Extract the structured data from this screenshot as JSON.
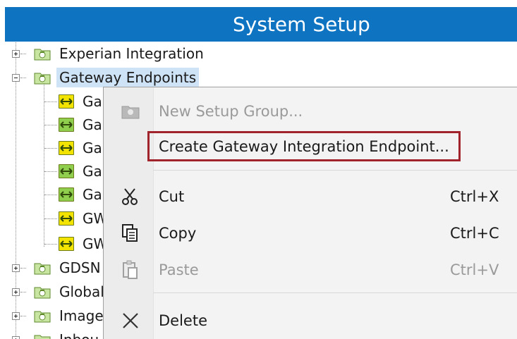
{
  "window": {
    "title": "System Setup"
  },
  "tree": {
    "nodes": [
      {
        "label": "Experian Integration",
        "expanded": false
      },
      {
        "label": "Gateway Endpoints",
        "expanded": true,
        "selected": true
      },
      {
        "label": "Ga",
        "icon_color": "yellow"
      },
      {
        "label": "Ga",
        "icon_color": "green"
      },
      {
        "label": "Ga",
        "icon_color": "yellow"
      },
      {
        "label": "Ga",
        "icon_color": "green"
      },
      {
        "label": "Ga",
        "icon_color": "green"
      },
      {
        "label": "GW",
        "icon_color": "yellow"
      },
      {
        "label": "GW",
        "icon_color": "yellow"
      },
      {
        "label": "GDSN",
        "expanded": false
      },
      {
        "label": "Global",
        "expanded": false
      },
      {
        "label": "Image",
        "expanded": false
      },
      {
        "label": "Inbou",
        "expanded": false
      }
    ]
  },
  "context_menu": {
    "items": [
      {
        "label": "New Setup Group...",
        "shortcut": "",
        "disabled": true,
        "icon": "folder-icon"
      },
      {
        "label": "Create Gateway Integration Endpoint...",
        "shortcut": "",
        "disabled": false,
        "highlighted": true
      },
      {
        "label": "Cut",
        "shortcut": "Ctrl+X",
        "disabled": false,
        "icon": "scissors-icon"
      },
      {
        "label": "Copy",
        "shortcut": "Ctrl+C",
        "disabled": false,
        "icon": "copy-icon"
      },
      {
        "label": "Paste",
        "shortcut": "Ctrl+V",
        "disabled": true,
        "icon": "paste-icon"
      },
      {
        "label": "Delete",
        "shortcut": "",
        "disabled": false,
        "icon": "delete-icon"
      }
    ]
  },
  "colors": {
    "title_bar": "#0e73c1",
    "highlight_border": "#a1232b",
    "selection": "#cfe3f7"
  }
}
